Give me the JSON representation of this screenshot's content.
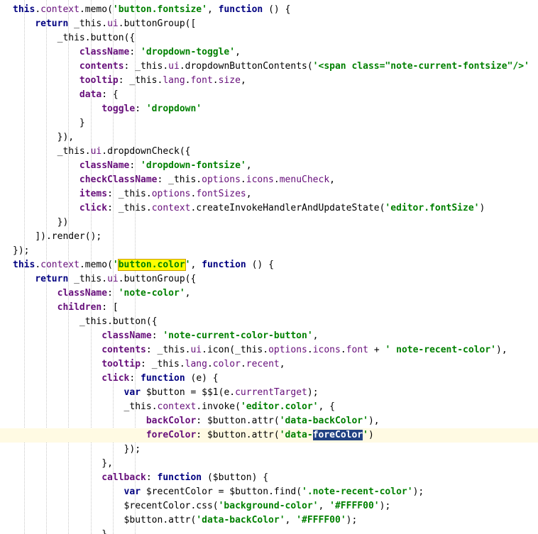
{
  "code_lines": [
    "this.context.memo('button.fontsize', function () {",
    "    return _this.ui.buttonGroup([",
    "        _this.button({",
    "            className: 'dropdown-toggle',",
    "            contents: _this.ui.dropdownButtonContents('<span class=\"note-current-fontsize\"/>'",
    "            tooltip: _this.lang.font.size,",
    "            data: {",
    "                toggle: 'dropdown'",
    "            }",
    "        }),",
    "        _this.ui.dropdownCheck({",
    "            className: 'dropdown-fontsize',",
    "            checkClassName: _this.options.icons.menuCheck,",
    "            items: _this.options.fontSizes,",
    "            click: _this.context.createInvokeHandlerAndUpdateState('editor.fontSize')",
    "        })",
    "    ]).render();",
    "});",
    "this.context.memo('button.color', function () {",
    "    return _this.ui.buttonGroup({",
    "        className: 'note-color',",
    "        children: [",
    "            _this.button({",
    "                className: 'note-current-color-button',",
    "                contents: _this.ui.icon(_this.options.icons.font + ' note-recent-color'),",
    "                tooltip: _this.lang.color.recent,",
    "                click: function (e) {",
    "                    var $button = $$1(e.currentTarget);",
    "                    _this.context.invoke('editor.color', {",
    "                        backColor: $button.attr('data-backColor'),",
    "                        foreColor: $button.attr('data-foreColor')",
    "                    });",
    "                },",
    "                callback: function ($button) {",
    "                    var $recentColor = $button.find('.note-recent-color');",
    "                    $recentColor.css('background-color', '#FFFF00');",
    "                    $button.attr('data-backColor', '#FFFF00');",
    "                }"
  ],
  "highlighted_search_term": "button.color",
  "selected_text": "foreColor",
  "current_line_index": 30
}
